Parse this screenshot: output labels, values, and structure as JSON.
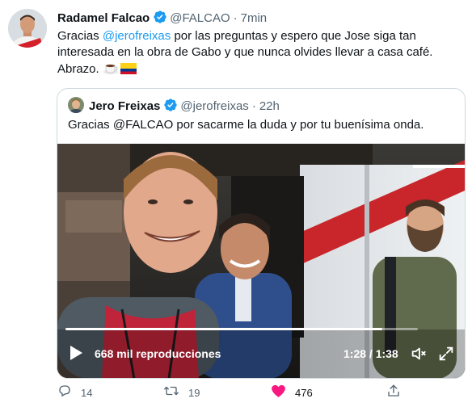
{
  "tweet": {
    "author_name": "Radamel Falcao",
    "handle": "@FALCAO",
    "separator": "·",
    "time": "7min",
    "text_before": "Gracias ",
    "mention": "@jerofreixas",
    "text_after": " por las preguntas y espero que Jose siga tan interesada en la obra de Gabo y que nunca olvides llevar a casa café. Abrazo.",
    "emojis": [
      "coffee-icon",
      "colombia-flag-icon"
    ]
  },
  "quoted": {
    "author_name": "Jero Freixas",
    "handle": "@jerofreixas",
    "separator": "·",
    "time": "22h",
    "text": "Gracias @FALCAO por sacarme la duda y por tu buenísima onda.",
    "video": {
      "views": "668 mil reproducciones",
      "time": "1:28 / 1:38",
      "progress": 0.898
    }
  },
  "actions": {
    "replies": "14",
    "retweets": "19",
    "likes": "476",
    "like_color": "#f91880"
  },
  "colors": {
    "verified": "#1d9bf0",
    "mention": "#1d9bf0",
    "muted": "#536471"
  }
}
